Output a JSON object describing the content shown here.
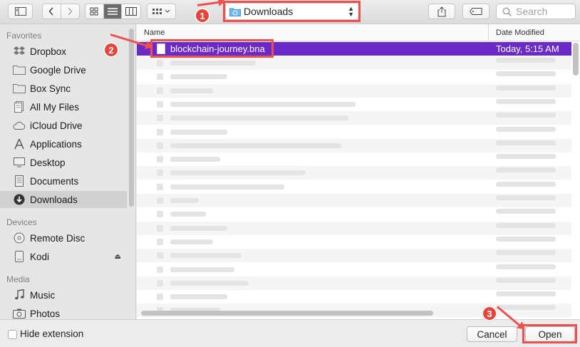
{
  "toolbar": {
    "location": "Downloads",
    "search_placeholder": "Search"
  },
  "sidebar": {
    "favorites_title": "Favorites",
    "favorites": [
      {
        "label": "Dropbox",
        "icon": "dropbox-icon"
      },
      {
        "label": "Google Drive",
        "icon": "folder-icon"
      },
      {
        "label": "Box Sync",
        "icon": "folder-icon"
      },
      {
        "label": "All My Files",
        "icon": "all-files-icon"
      },
      {
        "label": "iCloud Drive",
        "icon": "cloud-icon"
      },
      {
        "label": "Applications",
        "icon": "applications-icon"
      },
      {
        "label": "Desktop",
        "icon": "desktop-icon"
      },
      {
        "label": "Documents",
        "icon": "documents-icon"
      },
      {
        "label": "Downloads",
        "icon": "downloads-icon",
        "selected": true
      }
    ],
    "devices_title": "Devices",
    "devices": [
      {
        "label": "Remote Disc",
        "icon": "disc-icon"
      },
      {
        "label": "Kodi",
        "icon": "drive-icon",
        "ejectable": true
      }
    ],
    "media_title": "Media",
    "media": [
      {
        "label": "Music",
        "icon": "music-icon"
      },
      {
        "label": "Photos",
        "icon": "camera-icon"
      }
    ]
  },
  "list": {
    "col_name": "Name",
    "col_date": "Date Modified",
    "selected_file": {
      "name": "blockchain-journey.bna",
      "date": "Today, 5:15 AM"
    }
  },
  "footer": {
    "hide_extension": "Hide extension",
    "cancel": "Cancel",
    "open": "Open"
  },
  "annotations": {
    "steps": [
      "1",
      "2",
      "3"
    ],
    "color": "#ef4f4f"
  },
  "colors": {
    "selection": "#6b2ac7",
    "accent": "#ef4f4f"
  }
}
